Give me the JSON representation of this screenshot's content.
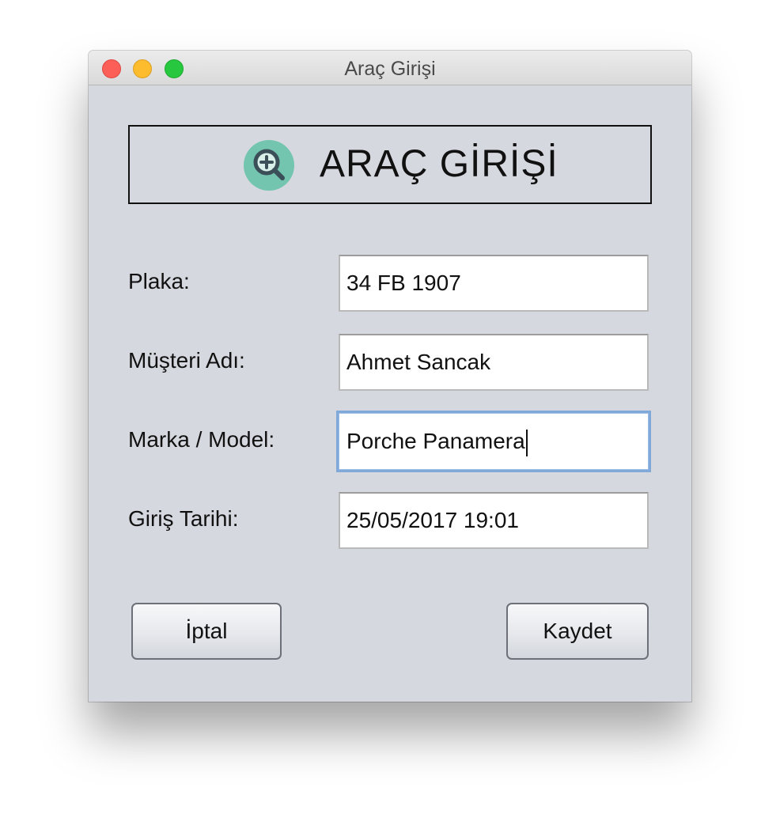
{
  "window": {
    "title": "Araç Girişi"
  },
  "header": {
    "title": "ARAÇ GİRİŞİ",
    "icon": "zoom-in-magnifier-icon",
    "icon_color": "#74c5b0"
  },
  "form": {
    "fields": [
      {
        "label": "Plaka:",
        "value": "34 FB 1907"
      },
      {
        "label": "Müşteri Adı:",
        "value": "Ahmet Sancak"
      },
      {
        "label": "Marka / Model:",
        "value": "Porche Panamera"
      },
      {
        "label": "Giriş Tarihi:",
        "value": "25/05/2017 19:01"
      }
    ]
  },
  "buttons": {
    "cancel": "İptal",
    "save": "Kaydet"
  },
  "colors": {
    "window_bg": "#d6d8df",
    "focus_ring": "#80a8d8",
    "close": "#fc5f57",
    "minimize": "#fdbc2e",
    "maximize": "#27c840"
  }
}
